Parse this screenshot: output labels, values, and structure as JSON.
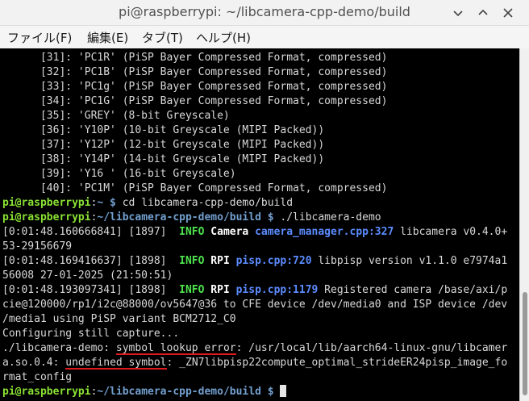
{
  "window": {
    "title": "pi@raspberrypi: ~/libcamera-cpp-demo/build"
  },
  "menu": {
    "file": "ファイル(F)",
    "edit": "編集(E)",
    "tabs": "タブ(T)",
    "help": "ヘルプ(H)"
  },
  "terminal": {
    "formats": [
      "      [31]: 'PC1R' (PiSP Bayer Compressed Format, compressed)",
      "      [32]: 'PC1B' (PiSP Bayer Compressed Format, compressed)",
      "      [33]: 'PC1g' (PiSP Bayer Compressed Format, compressed)",
      "      [34]: 'PC1G' (PiSP Bayer Compressed Format, compressed)",
      "      [35]: 'GREY' (8-bit Greyscale)",
      "      [36]: 'Y10P' (10-bit Greyscale (MIPI Packed))",
      "      [37]: 'Y12P' (12-bit Greyscale (MIPI Packed))",
      "      [38]: 'Y14P' (14-bit Greyscale (MIPI Packed))",
      "      [39]: 'Y16 ' (16-bit Greyscale)",
      "      [40]: 'PC1M' (PiSP Bayer Compressed Format, compressed)"
    ],
    "prompt_user": "pi@raspberrypi",
    "prompt_sep": ":",
    "prompt1_path": "~ $",
    "cmd1": " cd libcamera-cpp-demo/build",
    "prompt2_path": "~/libcamera-cpp-demo/build $",
    "cmd2": " ./libcamera-demo",
    "log1": {
      "prefix": "[0:01:48.160666841] [1897]  ",
      "level": "INFO",
      "category": "Camera",
      "source": "camera_manager.cpp:327",
      "msg": " libcamera v0.4.0+",
      "cont": "53-29156679"
    },
    "log2": {
      "prefix": "[0:01:48.169416637] [1898]  ",
      "level": "INFO",
      "category": "RPI",
      "source": "pisp.cpp:720",
      "msg": " libpisp version v1.1.0 e7974a1",
      "cont": "56008 27-01-2025 (21:50:51)"
    },
    "log3": {
      "prefix": "[0:01:48.193097341] [1898]  ",
      "level": "INFO",
      "category": "RPI",
      "source": "pisp.cpp:1179",
      "msg": " Registered camera /base/axi/p",
      "cont1": "cie@120000/rp1/i2c@88000/ov5647@36 to CFE device /dev/media0 and ISP device /dev",
      "cont2": "/media1 using PiSP variant BCM2712_C0"
    },
    "configuring": "Configuring still capture...",
    "err_prefix": "./libcamera-demo: ",
    "err_highlight": "symbol lookup error",
    "err_rest": ": /usr/local/lib/aarch64-linux-gnu/libcamer",
    "err2_prefix": "a.so.0.4: ",
    "err2_highlight": "undefined symbol",
    "err2_rest": ": _ZN7libpisp22compute_optimal_strideER24pisp_image_fo",
    "err3": "rmat_config",
    "prompt3_path": "~/libcamera-cpp-demo/build $",
    "prompt3_after": " "
  },
  "colors": {
    "underline_annotation": "#e0191e",
    "prompt_user": "#8ae234",
    "prompt_path": "#729fcf",
    "info": "#4ee44e",
    "source_link": "#5c8cff"
  }
}
